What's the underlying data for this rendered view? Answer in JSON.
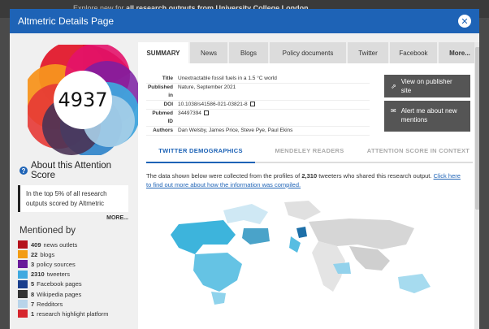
{
  "backdrop": {
    "text_pre": "Explore new for ",
    "text_bold": "all research outputs from University College London"
  },
  "modal": {
    "title": "Altmetric Details Page",
    "close_icon": "close-icon"
  },
  "score": {
    "value": "4937"
  },
  "about": {
    "title": "About this Attention Score",
    "text": "In the top 5% of all research outputs scored by Altmetric",
    "more": "MORE..."
  },
  "mentioned": {
    "title": "Mentioned by",
    "items": [
      {
        "count": "409",
        "label": "news outlets",
        "color": "#b5121b"
      },
      {
        "count": "22",
        "label": "blogs",
        "color": "#f39c12"
      },
      {
        "count": "3",
        "label": "policy sources",
        "color": "#6a1b9a"
      },
      {
        "count": "2310",
        "label": "tweeters",
        "color": "#3fa9e0"
      },
      {
        "count": "5",
        "label": "Facebook pages",
        "color": "#1a3e8c"
      },
      {
        "count": "8",
        "label": "Wikipedia pages",
        "color": "#333333"
      },
      {
        "count": "7",
        "label": "Redditors",
        "color": "#b8d4ea"
      },
      {
        "count": "1",
        "label": "research highlight platform",
        "color": "#d6262e"
      }
    ]
  },
  "tabs": [
    "SUMMARY",
    "News",
    "Blogs",
    "Policy documents",
    "Twitter",
    "Facebook",
    "More..."
  ],
  "meta": {
    "title_k": "Title",
    "title_v": "Unextractable fossil fuels in a 1.5 °C world",
    "pub_k": "Published in",
    "pub_v": "Nature, September 2021",
    "doi_k": "DOI",
    "doi_v": "10.1038/s41586-021-03821-8",
    "pmid_k": "Pubmed ID",
    "pmid_v": "34497394",
    "authors_k": "Authors",
    "authors_v": "Dan Welsby, James Price, Steve Pye, Paul Ekins"
  },
  "actions": {
    "publisher": "View on publisher site",
    "alert": "Alert me about new mentions"
  },
  "subtabs": [
    "TWITTER DEMOGRAPHICS",
    "MENDELEY READERS",
    "ATTENTION SCORE IN CONTEXT"
  ],
  "demographics": {
    "pre": "The data shown below were collected from the profiles of ",
    "count": "2,310",
    "mid": " tweeters who shared this research output. ",
    "link": "Click here to find out more about how the information was compiled."
  }
}
